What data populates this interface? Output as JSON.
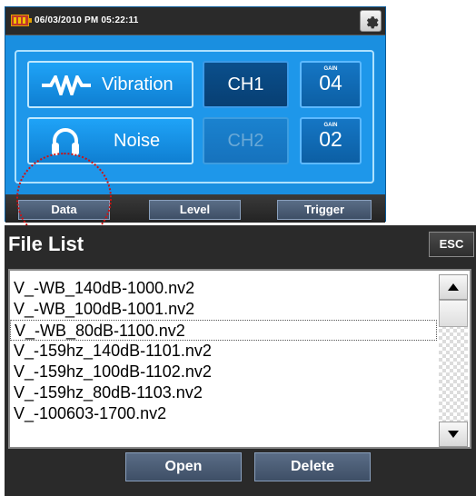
{
  "status": {
    "datetime": "06/03/2010 PM 05:22:11",
    "battery_icon": "battery-icon",
    "settings_icon": "gear-icon"
  },
  "channels": [
    {
      "label": "Vibration",
      "icon": "vibration-wave-icon",
      "channel": "CH1",
      "channel_enabled": true,
      "gain_caption": "GAIN",
      "gain_value": "04"
    },
    {
      "label": "Noise",
      "icon": "headphones-icon",
      "channel": "CH2",
      "channel_enabled": false,
      "gain_caption": "GAIN",
      "gain_value": "02"
    }
  ],
  "tabs": [
    "Data",
    "Level",
    "Trigger"
  ],
  "file_list": {
    "title": "File List",
    "esc_label": "ESC",
    "files": [
      "V_-WB_140dB-1000.nv2",
      "V_-WB_100dB-1001.nv2",
      "V_-WB_80dB-1100.nv2",
      "V_-159hz_140dB-1101.nv2",
      "V_-159hz_100dB-1102.nv2",
      "V_-159hz_80dB-1103.nv2",
      "V_-100603-1700.nv2"
    ],
    "selected_index": 2,
    "open_label": "Open",
    "delete_label": "Delete"
  },
  "colors": {
    "screen_blue": "#1a8fe0",
    "annotation_red": "#d01010"
  }
}
